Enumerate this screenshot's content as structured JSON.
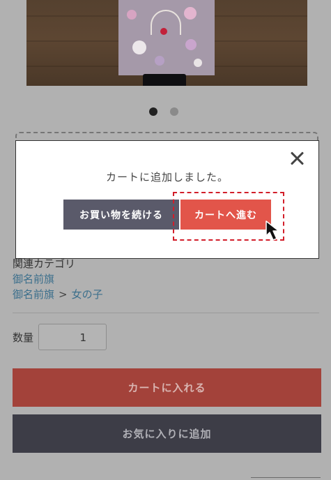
{
  "modal": {
    "message": "カートに追加しました。",
    "continue_label": "お買い物を続ける",
    "cart_label": "カートへ進む"
  },
  "category": {
    "heading": "関連カテゴリ",
    "link1": "御名前旗",
    "link2_parent": "御名前旗",
    "separator": ">",
    "link2_child": "女の子"
  },
  "quantity": {
    "label": "数量",
    "value": "1"
  },
  "actions": {
    "add_to_cart": "カートに入れる",
    "add_favorite": "お気に入りに追加"
  },
  "carousel": {
    "active_slide": 1,
    "slides": 2
  },
  "colors": {
    "overlay": "#b1b1b1",
    "continue_button": "#5a5a6a",
    "cart_button": "#e2554a",
    "highlight": "#d21e2a",
    "link": "#3c6f8c"
  }
}
